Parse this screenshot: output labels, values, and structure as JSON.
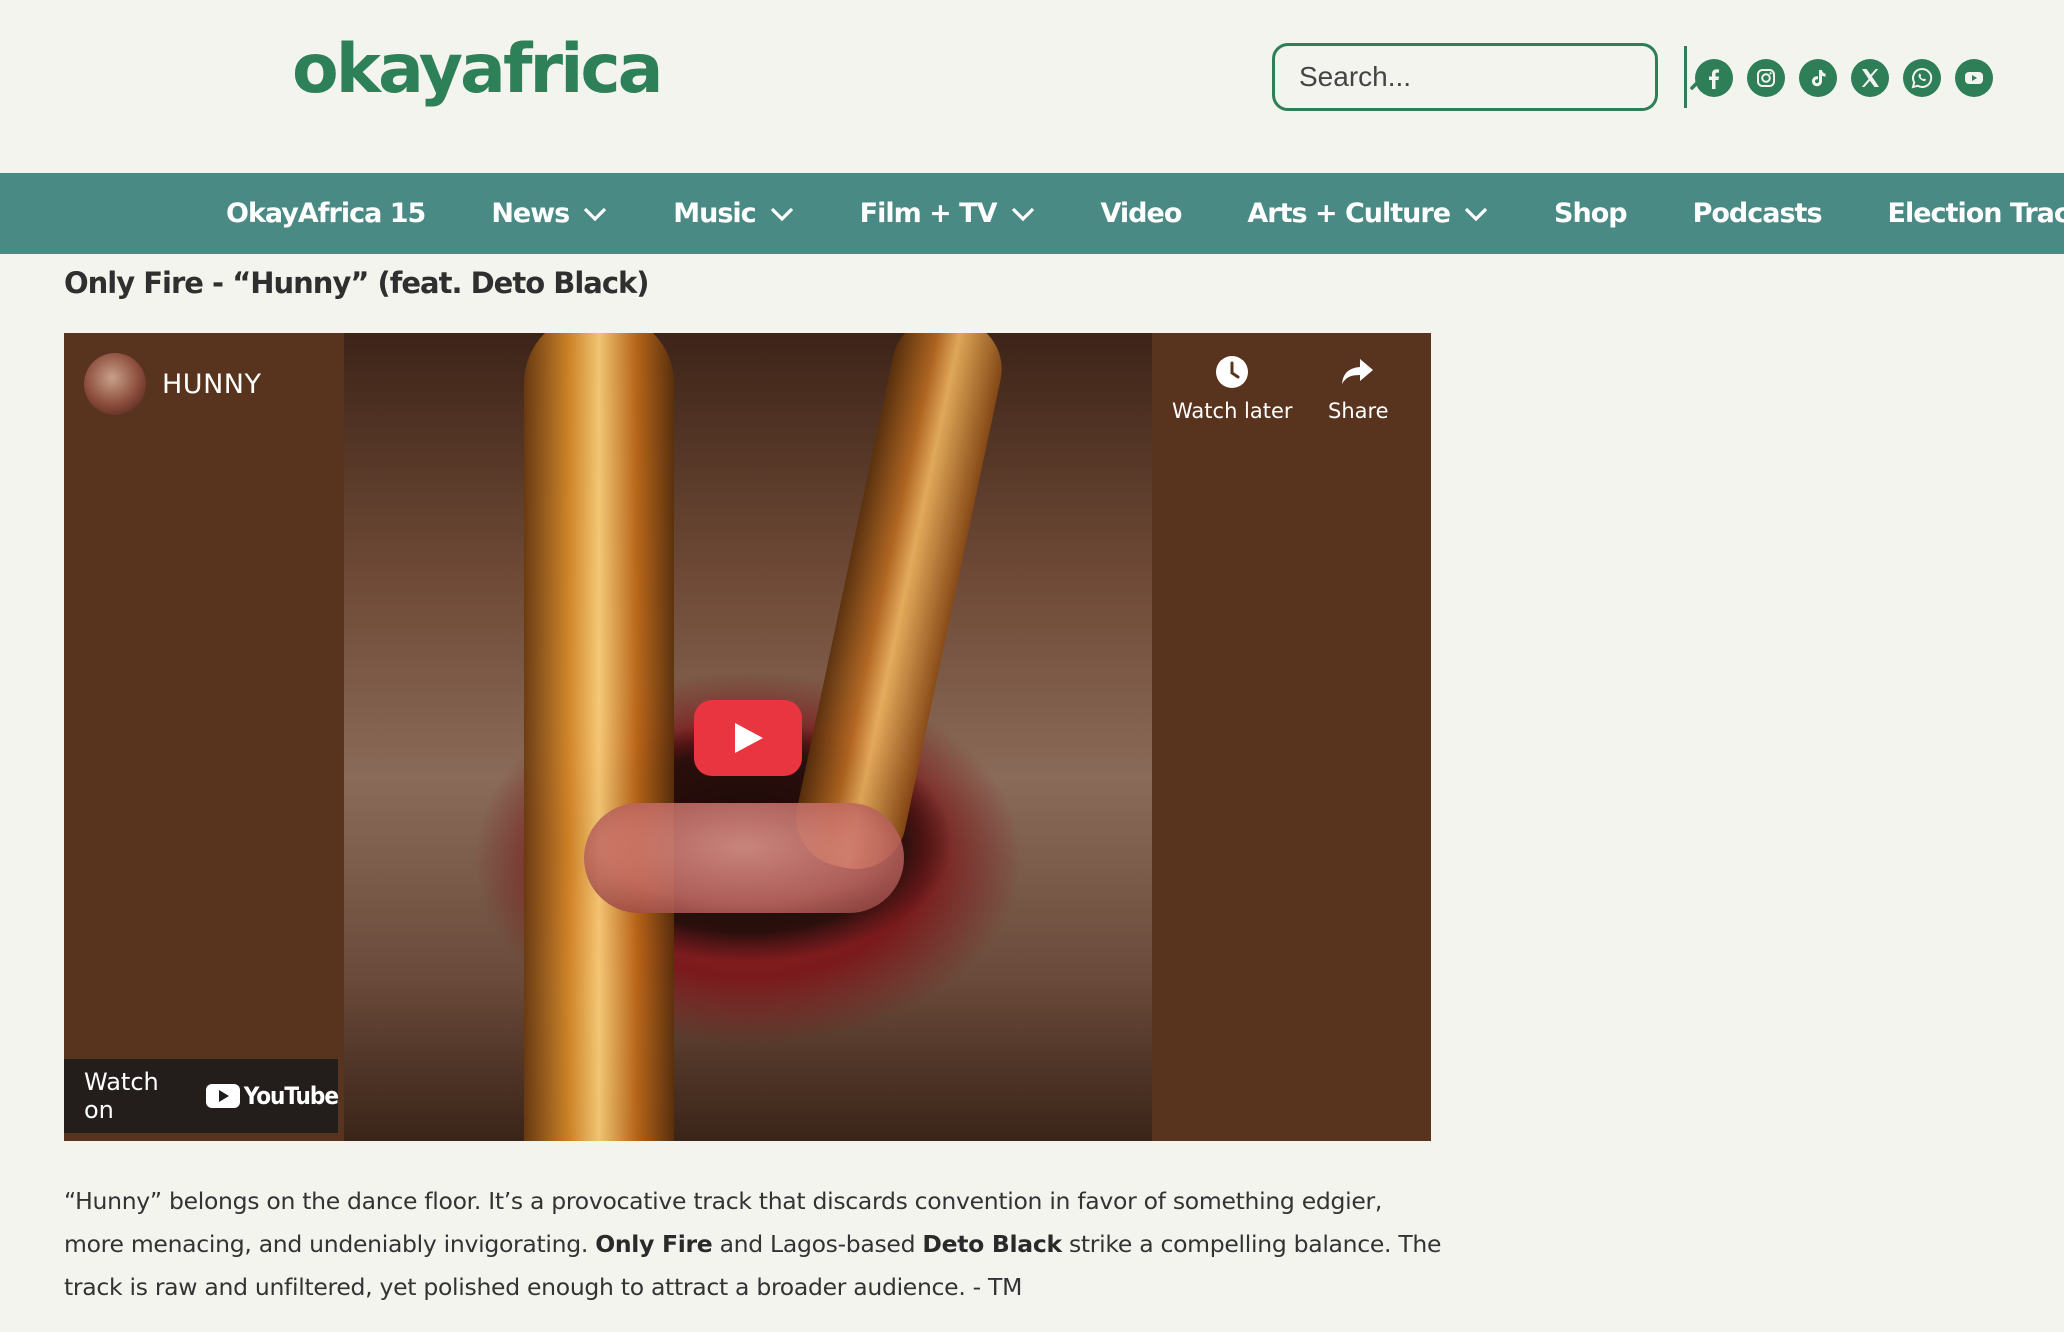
{
  "header": {
    "logo": "okayafrica",
    "search_placeholder": "Search...",
    "social_icons": [
      "facebook-icon",
      "instagram-icon",
      "tiktok-icon",
      "x-icon",
      "whatsapp-icon",
      "youtube-icon"
    ]
  },
  "nav": {
    "items": [
      {
        "label": "OkayAfrica 15",
        "dropdown": false
      },
      {
        "label": "News",
        "dropdown": true
      },
      {
        "label": "Music",
        "dropdown": true
      },
      {
        "label": "Film + TV",
        "dropdown": true
      },
      {
        "label": "Video",
        "dropdown": false
      },
      {
        "label": "Arts + Culture",
        "dropdown": true
      },
      {
        "label": "Shop",
        "dropdown": false
      },
      {
        "label": "Podcasts",
        "dropdown": false
      },
      {
        "label": "Election Tracker",
        "dropdown": false
      }
    ]
  },
  "article": {
    "heading": "Only Fire - “Hunny” (feat. Deto Black)",
    "video": {
      "channel_title": "HUNNY",
      "watch_later": "Watch later",
      "share": "Share",
      "watch_on": "Watch on",
      "youtube": "YouTube"
    },
    "body": {
      "part1": "“Hunny” belongs on the dance floor. It’s a provocative track that discards convention in favor of something edgier, more menacing, and undeniably invigorating. ",
      "artist1": "Only Fire",
      "part2": " and Lagos-based ",
      "artist2": "Deto Black",
      "part3": " strike a compelling balance. The track is raw and unfiltered, yet polished enough to attract a broader audience. - TM"
    }
  },
  "colors": {
    "brand_green": "#2e8059",
    "nav_teal": "#4a8a84",
    "background": "#f4f4ef",
    "play_red": "#e8353f"
  }
}
